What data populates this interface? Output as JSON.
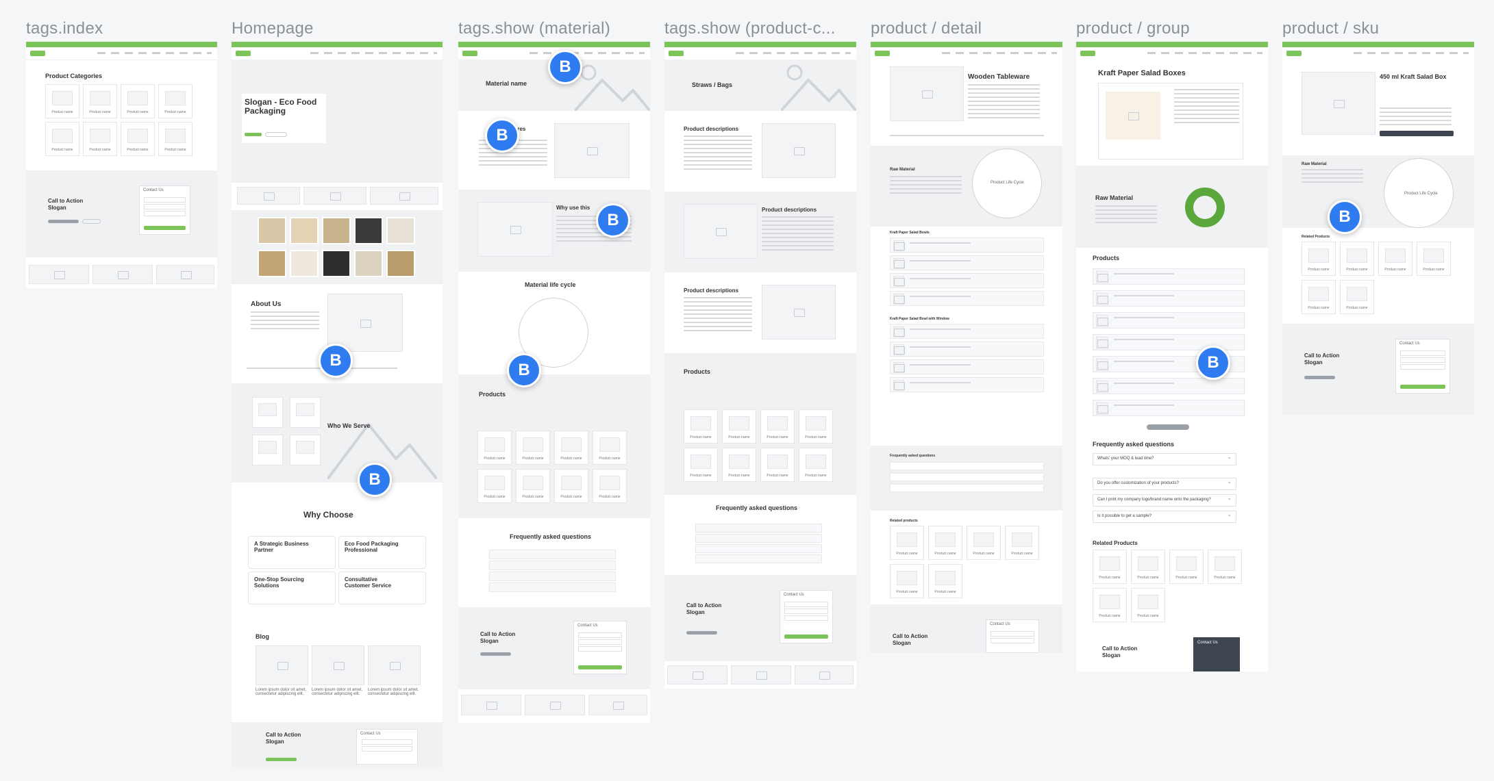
{
  "frames": [
    {
      "id": "tags-index",
      "title": "tags.index"
    },
    {
      "id": "homepage",
      "title": "Homepage"
    },
    {
      "id": "tags-show-material",
      "title": "tags.show (material)"
    },
    {
      "id": "tags-show-product",
      "title": "tags.show (product-c..."
    },
    {
      "id": "product-detail",
      "title": "product / detail"
    },
    {
      "id": "product-group",
      "title": "product / group"
    },
    {
      "id": "product-sku",
      "title": "product / sku"
    }
  ],
  "badge_letter": "B",
  "colors": {
    "accent": "#7cc45a",
    "badge": "#2f7cf0",
    "canvas": "#f5f6f8",
    "section_grey": "#f0f1f3"
  },
  "tags_index": {
    "heading": "Product Categories",
    "card_label": "Product name",
    "cta_title": "Call to Action Slogan",
    "contact_title": "Contact Us"
  },
  "homepage": {
    "hero_title": "Slogan - Eco Food Packaging",
    "about_title": "About Us",
    "who_title": "Who We Serve",
    "why_title": "Why Choose",
    "why_cards": [
      "A Strategic Business Partner",
      "Eco Food Packaging Professional",
      "One-Stop Sourcing Solutions",
      "Consultative Customer Service"
    ],
    "blog_title": "Blog",
    "blog_text": "Lorem ipsum dolor sit amet, consectetur adipiscing elit.",
    "cta_title": "Call to Action Slogan",
    "contact_title": "Contact Us"
  },
  "material": {
    "hero_title": "Material name",
    "features_title": "Features",
    "why_title": "Why use this",
    "lifecycle_title": "Material life cycle",
    "products_title": "Products",
    "card_label": "Product name",
    "faq_title": "Frequently asked questions",
    "cta_title": "Call to Action Slogan",
    "contact_title": "Contact Us"
  },
  "product_category": {
    "hero_title": "Straws / Bags",
    "desc_title": "Product descriptions",
    "products_title": "Products",
    "card_label": "Product name",
    "faq_title": "Frequently asked questions",
    "cta_title": "Call to Action Slogan",
    "contact_title": "Contact Us"
  },
  "product_detail": {
    "title": "Wooden Tableware",
    "raw_material": "Raw Material",
    "life_cycle": "Product Life Cycle",
    "table1": "Kraft Paper Salad Bowls",
    "table2": "Kraft Paper Salad Bowl with Window",
    "faq_title": "Frequently asked questions",
    "related_title": "Related products",
    "card_label": "Product name",
    "cta_title": "Call to Action Slogan",
    "contact_title": "Contact Us"
  },
  "product_group": {
    "title": "Kraft Paper Salad Boxes",
    "raw_material": "Raw Material",
    "products_title": "Products",
    "faq_title": "Frequently asked questions",
    "faqs": [
      "Whats' your MOQ & lead time?",
      "Do you offer customization of your products?",
      "Can I print my company logo/brand name onto the packaging?",
      "Is it possible to get a sample?"
    ],
    "related_title": "Related Products",
    "card_label": "Product name",
    "cta_title": "Call to Action Slogan",
    "contact_title": "Contact Us"
  },
  "product_sku": {
    "title": "450 ml Kraft Salad Box",
    "raw_material": "Raw Material",
    "life_cycle": "Product Life Cycle",
    "related_title": "Related Products",
    "card_label": "Product name",
    "cta_title": "Call to Action Slogan",
    "contact_title": "Contact Us"
  }
}
